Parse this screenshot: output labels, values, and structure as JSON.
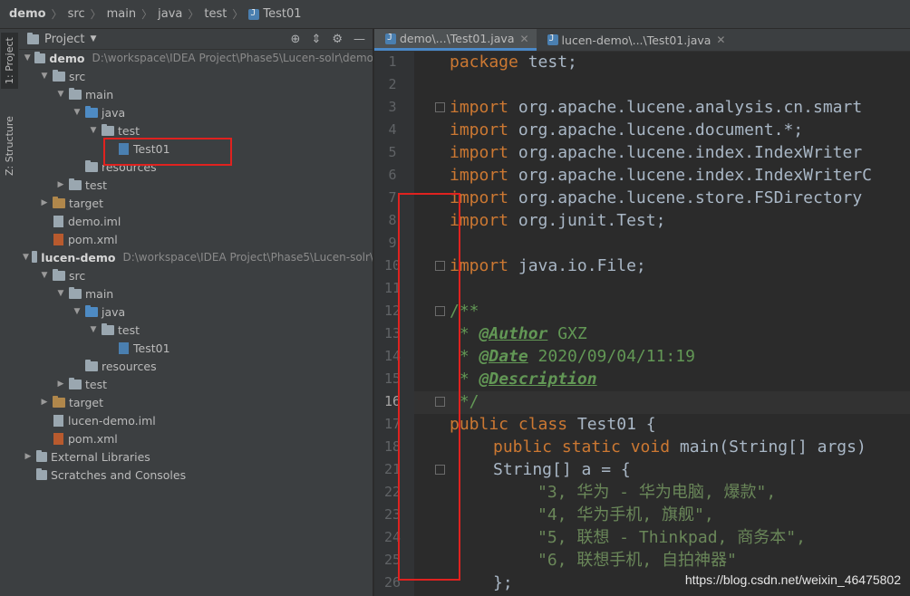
{
  "breadcrumb": [
    "demo",
    "src",
    "main",
    "java",
    "test",
    "Test01"
  ],
  "side_tabs": {
    "project": "1: Project",
    "structure": "Z: Structure"
  },
  "project_panel": {
    "title": "Project",
    "tool_icons": [
      "target-icon",
      "collapse-icon",
      "gear-icon",
      "minimize-icon"
    ]
  },
  "tree": [
    {
      "label": "demo",
      "path": "D:\\workspace\\IDEA Project\\Phase5\\Lucen-solr\\demo",
      "bold": true
    },
    {
      "label": "src"
    },
    {
      "label": "main"
    },
    {
      "label": "java"
    },
    {
      "label": "test"
    },
    {
      "label": "Test01"
    },
    {
      "label": "resources"
    },
    {
      "label": "test"
    },
    {
      "label": "target"
    },
    {
      "label": "demo.iml"
    },
    {
      "label": "pom.xml"
    },
    {
      "label": "lucen-demo",
      "path": "D:\\workspace\\IDEA Project\\Phase5\\Lucen-solr\\",
      "bold": true
    },
    {
      "label": "src"
    },
    {
      "label": "main"
    },
    {
      "label": "java"
    },
    {
      "label": "test"
    },
    {
      "label": "Test01"
    },
    {
      "label": "resources"
    },
    {
      "label": "test"
    },
    {
      "label": "target"
    },
    {
      "label": "lucen-demo.iml"
    },
    {
      "label": "pom.xml"
    },
    {
      "label": "External Libraries"
    },
    {
      "label": "Scratches and Consoles"
    }
  ],
  "editor_tabs": [
    {
      "label": "demo\\...\\Test01.java"
    },
    {
      "label": "lucen-demo\\...\\Test01.java"
    }
  ],
  "line_numbers": [
    "1",
    "2",
    "3",
    "4",
    "5",
    "6",
    "7",
    "8",
    "9",
    "10",
    "11",
    "12",
    "13",
    "14",
    "15",
    "16",
    "17",
    "18",
    "21",
    "22",
    "23",
    "24",
    "25",
    "26"
  ],
  "code": {
    "l1a": "package",
    "l1b": " test;",
    "imp": "import",
    "l3": " org.apache.lucene.analysis.cn.smart",
    "l4": " org.apache.lucene.document.*;",
    "l5": " org.apache.lucene.index.IndexWriter",
    "l6": " org.apache.lucene.index.IndexWriterC",
    "l7": " org.apache.lucene.store.FSDirectory",
    "l8": " org.junit.Test;",
    "l10": " java.io.File;",
    "l12": "/**",
    "star": " * ",
    "author_tag": "@Author",
    "author_val": " GXZ",
    "date_tag": "@Date",
    "date_val": " 2020/09/04/11:19",
    "desc_tag": "@Description",
    "l16": " */",
    "l17a": "public class",
    "l17b": " Test01 {",
    "l18a": "public static void",
    "l18b": " main(String[] args)",
    "l21": "String[] a = {",
    "l22": "\"3, 华为 - 华为电脑, 爆款\",",
    "l23": "\"4, 华为手机, 旗舰\",",
    "l24": "\"5, 联想 - Thinkpad, 商务本\",",
    "l25": "\"6, 联想手机, 自拍神器\"",
    "l26": "};"
  },
  "watermark": "https://blog.csdn.net/weixin_46475802",
  "colors": {
    "highlight_box": "#e0221f",
    "keyword": "#cc7832",
    "comment": "#629755",
    "string": "#6a8759"
  }
}
